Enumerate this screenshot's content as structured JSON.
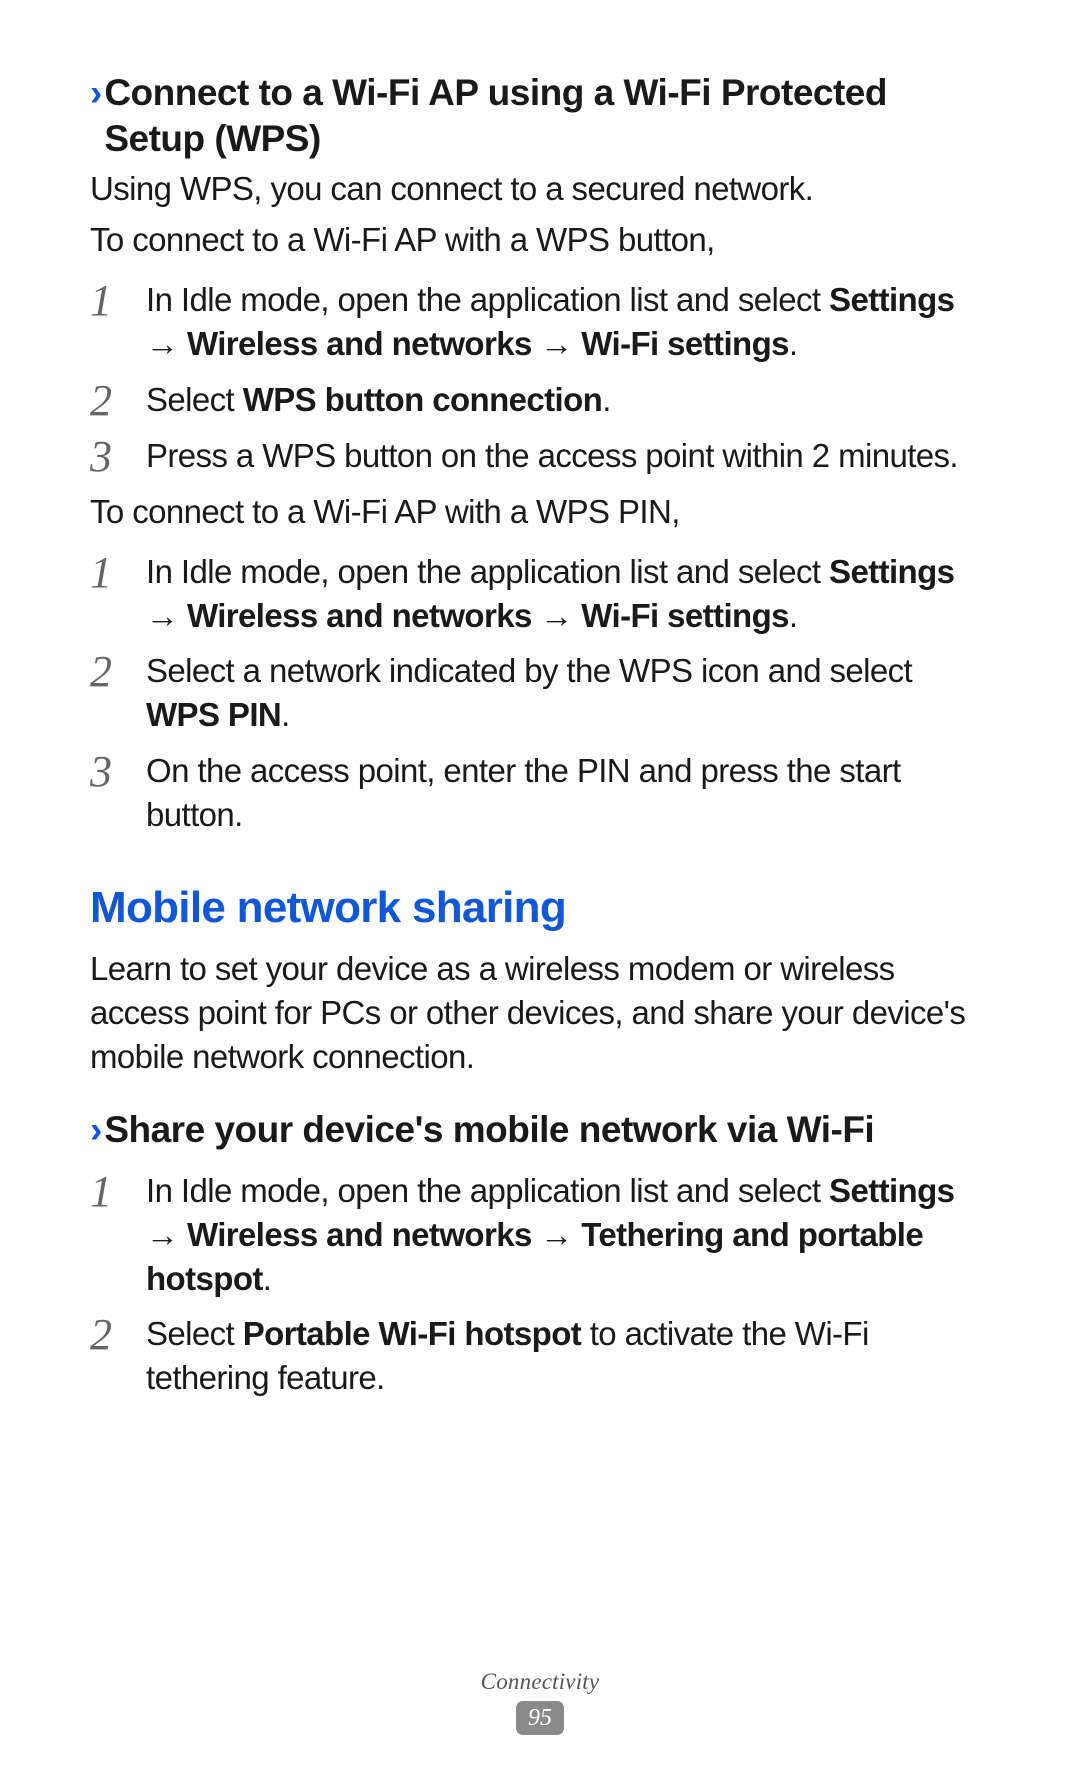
{
  "section1": {
    "heading": "Connect to a Wi-Fi AP using a Wi-Fi Protected Setup (WPS)",
    "intro1": "Using WPS, you can connect to a secured network.",
    "intro2": "To connect to a Wi-Fi AP with a WPS button,",
    "stepsA": {
      "s1a": "In Idle mode, open the application list and select ",
      "s1b": "Settings",
      "s1c": " → ",
      "s1d": "Wireless and networks",
      "s1e": " → ",
      "s1f": "Wi-Fi settings",
      "s1g": ".",
      "s2a": "Select ",
      "s2b": "WPS button connection",
      "s2c": ".",
      "s3": "Press a WPS button on the access point within 2 minutes."
    },
    "mid": "To connect to a Wi-Fi AP with a WPS PIN,",
    "stepsB": {
      "s1a": "In Idle mode, open the application list and select ",
      "s1b": "Settings",
      "s1c": " → ",
      "s1d": "Wireless and networks",
      "s1e": " → ",
      "s1f": "Wi-Fi settings",
      "s1g": ".",
      "s2a": "Select a network indicated by the WPS icon and select ",
      "s2b": "WPS PIN",
      "s2c": ".",
      "s3": "On the access point, enter the PIN and press the start button."
    }
  },
  "section2": {
    "heading": "Mobile network sharing",
    "intro": "Learn to set your device as a wireless modem or wireless access point for PCs or other devices, and share your device's mobile network connection.",
    "sub": {
      "heading": "Share your device's mobile network via Wi-Fi",
      "steps": {
        "s1a": "In Idle mode, open the application list and select ",
        "s1b": "Settings",
        "s1c": " → ",
        "s1d": "Wireless and networks",
        "s1e": " → ",
        "s1f": "Tethering and portable hotspot",
        "s1g": ".",
        "s2a": "Select ",
        "s2b": "Portable Wi-Fi hotspot",
        "s2c": " to activate the Wi-Fi tethering feature."
      }
    }
  },
  "footer": {
    "section": "Connectivity",
    "page": "95"
  }
}
